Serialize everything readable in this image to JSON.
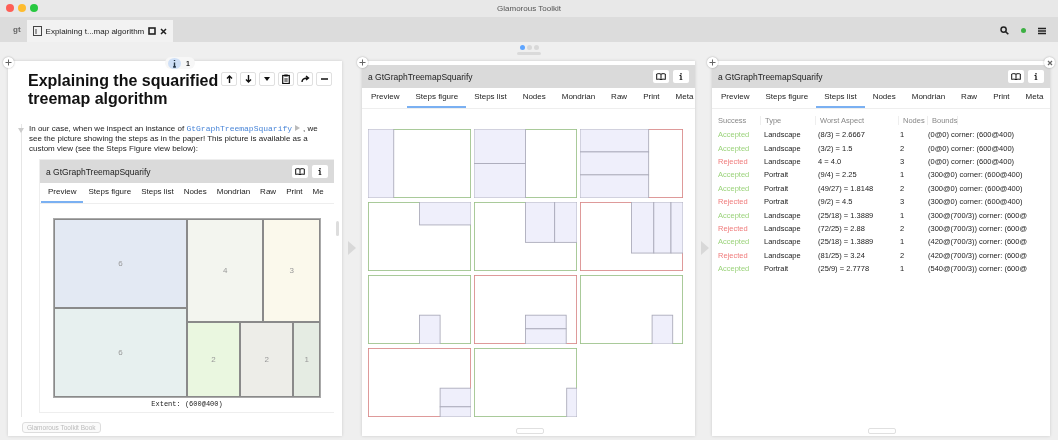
{
  "window": {
    "title": "Glamorous Toolkit"
  },
  "tab_bar": {
    "logo": "gt",
    "tabs": [
      {
        "label": "Explaining t...map algorithm",
        "selected": true
      }
    ]
  },
  "pager": {
    "pages": [
      {
        "selected": true
      },
      {
        "selected": false
      },
      {
        "selected": false
      }
    ]
  },
  "page_pane": {
    "badge": "1",
    "title": "Explaining the squarified treemap algorithm",
    "paragraph": {
      "before": "In our case, when we inspect an instance of ",
      "code": "GtGraphTreemapSquarify",
      "after": ", we see the picture showing the steps as in the paper! This picture is available as a custom view (see the Steps Figure view below):"
    },
    "embedded_view": {
      "title": "a GtGraphTreemapSquarify",
      "tabs": [
        {
          "label": "Preview",
          "selected": true
        },
        {
          "label": "Steps figure",
          "selected": false
        },
        {
          "label": "Steps list",
          "selected": false
        },
        {
          "label": "Nodes",
          "selected": false
        },
        {
          "label": "Mondrian",
          "selected": false
        },
        {
          "label": "Raw",
          "selected": false
        },
        {
          "label": "Print",
          "selected": false
        },
        {
          "label": "Me",
          "selected": false
        }
      ],
      "treemap": {
        "nodes": [
          {
            "label": "6",
            "color": "#e3e9f3"
          },
          {
            "label": "4",
            "color": "#f3f5ef"
          },
          {
            "label": "3",
            "color": "#fbf9ec"
          },
          {
            "label": "6",
            "color": "#e7f0ef"
          },
          {
            "label": "2",
            "color": "#eaf7e0"
          },
          {
            "label": "2",
            "color": "#edede8"
          },
          {
            "label": "1",
            "color": "#e5ece3"
          }
        ]
      },
      "caption": "Extent: (600@400)"
    },
    "book_button": "Glamorous Toolkit Book"
  },
  "steps_figure_pane": {
    "title": "a GtGraphTreemapSquarify",
    "tabs": [
      {
        "label": "Preview",
        "selected": false
      },
      {
        "label": "Steps figure",
        "selected": true
      },
      {
        "label": "Steps list",
        "selected": false
      },
      {
        "label": "Nodes",
        "selected": false
      },
      {
        "label": "Mondrian",
        "selected": false
      },
      {
        "label": "Raw",
        "selected": false
      },
      {
        "label": "Print",
        "selected": false
      },
      {
        "label": "Meta",
        "selected": false
      }
    ],
    "steps": [
      {
        "accepted": true
      },
      {
        "accepted": true
      },
      {
        "accepted": false
      },
      {
        "accepted": true
      },
      {
        "accepted": true
      },
      {
        "accepted": false
      },
      {
        "accepted": true
      },
      {
        "accepted": false
      },
      {
        "accepted": true
      },
      {
        "accepted": false
      },
      {
        "accepted": true
      }
    ]
  },
  "steps_list_pane": {
    "title": "a GtGraphTreemapSquarify",
    "tabs": [
      {
        "label": "Preview",
        "selected": false
      },
      {
        "label": "Steps figure",
        "selected": false
      },
      {
        "label": "Steps list",
        "selected": true
      },
      {
        "label": "Nodes",
        "selected": false
      },
      {
        "label": "Mondrian",
        "selected": false
      },
      {
        "label": "Raw",
        "selected": false
      },
      {
        "label": "Print",
        "selected": false
      },
      {
        "label": "Meta",
        "selected": false
      }
    ],
    "table": {
      "columns": [
        "Success",
        "Type",
        "Worst Aspect",
        "Nodes",
        "Bounds"
      ],
      "rows": [
        {
          "success": "Accepted",
          "accepted": true,
          "type": "Landscape",
          "worst_aspect": "(8/3) = 2.6667",
          "nodes": "1",
          "bounds": "(0@0) corner: (600@400)"
        },
        {
          "success": "Accepted",
          "accepted": true,
          "type": "Landscape",
          "worst_aspect": "(3/2) = 1.5",
          "nodes": "2",
          "bounds": "(0@0) corner: (600@400)"
        },
        {
          "success": "Rejected",
          "accepted": false,
          "type": "Landscape",
          "worst_aspect": "4 = 4.0",
          "nodes": "3",
          "bounds": "(0@0) corner: (600@400)"
        },
        {
          "success": "Accepted",
          "accepted": true,
          "type": "Portrait",
          "worst_aspect": "(9/4) = 2.25",
          "nodes": "1",
          "bounds": "(300@0) corner: (600@400)"
        },
        {
          "success": "Accepted",
          "accepted": true,
          "type": "Portrait",
          "worst_aspect": "(49/27) = 1.8148",
          "nodes": "2",
          "bounds": "(300@0) corner: (600@400)"
        },
        {
          "success": "Rejected",
          "accepted": false,
          "type": "Portrait",
          "worst_aspect": "(9/2) = 4.5",
          "nodes": "3",
          "bounds": "(300@0) corner: (600@400)"
        },
        {
          "success": "Accepted",
          "accepted": true,
          "type": "Landscape",
          "worst_aspect": "(25/18) = 1.3889",
          "nodes": "1",
          "bounds": "(300@(700/3)) corner: (600@"
        },
        {
          "success": "Rejected",
          "accepted": false,
          "type": "Landscape",
          "worst_aspect": "(72/25) = 2.88",
          "nodes": "2",
          "bounds": "(300@(700/3)) corner: (600@"
        },
        {
          "success": "Accepted",
          "accepted": true,
          "type": "Landscape",
          "worst_aspect": "(25/18) = 1.3889",
          "nodes": "1",
          "bounds": "(420@(700/3)) corner: (600@"
        },
        {
          "success": "Rejected",
          "accepted": false,
          "type": "Landscape",
          "worst_aspect": "(81/25) = 3.24",
          "nodes": "2",
          "bounds": "(420@(700/3)) corner: (600@"
        },
        {
          "success": "Accepted",
          "accepted": true,
          "type": "Portrait",
          "worst_aspect": "(25/9) = 2.7778",
          "nodes": "1",
          "bounds": "(540@(700/3)) corner: (600@"
        }
      ]
    }
  }
}
